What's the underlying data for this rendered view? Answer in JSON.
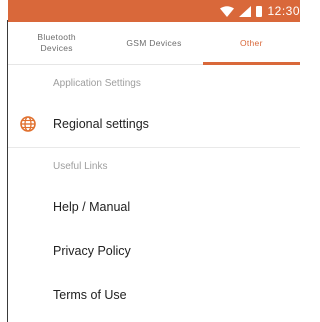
{
  "status_bar": {
    "time": "12:30",
    "color": "#d9683a"
  },
  "tabs": [
    {
      "label": "Bluetooth\nDevices",
      "active": false
    },
    {
      "label": "GSM Devices",
      "active": false
    },
    {
      "label": "Other",
      "active": true
    }
  ],
  "sections": {
    "application_settings": {
      "header": "Application Settings",
      "items": [
        {
          "label": "Regional settings",
          "icon": "globe-icon"
        }
      ]
    },
    "useful_links": {
      "header": "Useful Links",
      "items": [
        {
          "label": "Help / Manual"
        },
        {
          "label": "Privacy Policy"
        },
        {
          "label": "Terms of Use"
        }
      ]
    }
  }
}
